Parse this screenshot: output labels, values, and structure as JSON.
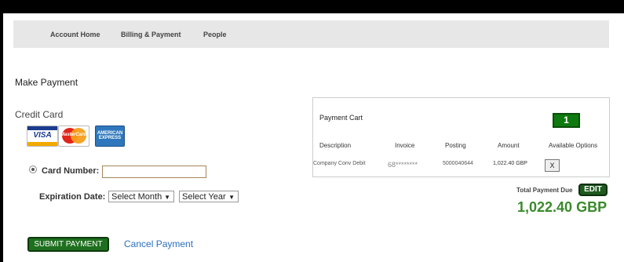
{
  "nav": {
    "items": [
      "Account Home",
      "Billing & Payment",
      "People"
    ]
  },
  "page": {
    "title": "Make Payment"
  },
  "credit_card": {
    "heading": "Credit Card",
    "cards": {
      "visa": "VISA",
      "mastercard": "MasterCard",
      "amex_line1": "AMERICAN",
      "amex_line2": "EXPRESS"
    },
    "card_number_label": "Card Number:",
    "card_number_value": "",
    "expiration_label": "Expiration Date:",
    "month_selected": "Select Month",
    "year_selected": "Select Year"
  },
  "cart": {
    "title": "Payment Cart",
    "count": "1",
    "headers": [
      "Description",
      "Invoice",
      "Posting",
      "Amount",
      "Available Options"
    ],
    "row": {
      "description": "Company Conv Debit",
      "invoice": "68********",
      "posting": "5000040644",
      "amount": "1,022.40 GBP",
      "remove": "X"
    }
  },
  "total": {
    "label": "Total Payment Due",
    "edit": "EDIT",
    "amount": "1,022.40 GBP"
  },
  "actions": {
    "submit": "SUBMIT PAYMENT",
    "cancel": "Cancel Payment"
  },
  "colors": {
    "green_button": "#1e6f1e",
    "total_green": "#3a8a2a",
    "link_blue": "#2a6fbf"
  }
}
